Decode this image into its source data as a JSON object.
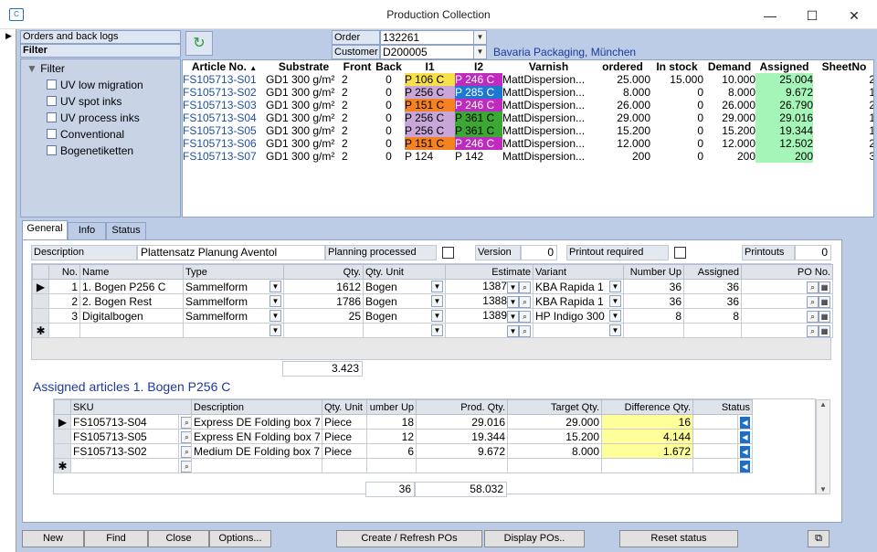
{
  "window": {
    "title": "Production Collection",
    "minimize": "—",
    "maximize": "☐",
    "close": "✕"
  },
  "left_panel": {
    "header1": "Orders and back logs",
    "header2": "Filter",
    "root": "Filter",
    "items": [
      "UV low migration",
      "UV spot inks",
      "UV process inks",
      "Conventional",
      "Bogenetiketten"
    ]
  },
  "order": {
    "order_label": "Order",
    "order_value": "132261",
    "customer_label": "Customer",
    "customer_value": "D200005",
    "customer_name": "Bavaria Packaging, München"
  },
  "articles": {
    "columns": [
      "Article No.",
      "Substrate",
      "Front",
      "Back",
      "I1",
      "I2",
      "Varnish",
      "ordered",
      "In stock",
      "Demand",
      "Assigned",
      "SheetNo"
    ],
    "rows": [
      {
        "article": "FS105713-S01",
        "substrate": "GD1 300 g/m²",
        "front": "2",
        "back": "0",
        "i1": "P 106 C",
        "i1_color": "#f7e04a",
        "i2": "P 246 C",
        "i2_color": "#c02bbf",
        "varnish": "MattDispersion...",
        "ordered": "25.000",
        "stock": "15.000",
        "demand": "10.000",
        "assigned": "25.004",
        "sheet": "2"
      },
      {
        "article": "FS105713-S02",
        "substrate": "GD1 300 g/m²",
        "front": "2",
        "back": "0",
        "i1": "P 256 C",
        "i1_color": "#c9a6d8",
        "i2": "P 285 C",
        "i2_color": "#1e78d2",
        "varnish": "MattDispersion...",
        "ordered": "8.000",
        "stock": "0",
        "demand": "8.000",
        "assigned": "9.672",
        "sheet": "1"
      },
      {
        "article": "FS105713-S03",
        "substrate": "GD1 300 g/m²",
        "front": "2",
        "back": "0",
        "i1": "P 151 C",
        "i1_color": "#f58220",
        "i2": "P 246 C",
        "i2_color": "#c02bbf",
        "varnish": "MattDispersion...",
        "ordered": "26.000",
        "stock": "0",
        "demand": "26.000",
        "assigned": "26.790",
        "sheet": "2"
      },
      {
        "article": "FS105713-S04",
        "substrate": "GD1 300 g/m²",
        "front": "2",
        "back": "0",
        "i1": "P 256 C",
        "i1_color": "#c9a6d8",
        "i2": "P 361 C",
        "i2_color": "#3aa832",
        "varnish": "MattDispersion...",
        "ordered": "29.000",
        "stock": "0",
        "demand": "29.000",
        "assigned": "29.016",
        "sheet": "1"
      },
      {
        "article": "FS105713-S05",
        "substrate": "GD1 300 g/m²",
        "front": "2",
        "back": "0",
        "i1": "P 256 C",
        "i1_color": "#c9a6d8",
        "i2": "P 361 C",
        "i2_color": "#3aa832",
        "varnish": "MattDispersion...",
        "ordered": "15.200",
        "stock": "0",
        "demand": "15.200",
        "assigned": "19.344",
        "sheet": "1"
      },
      {
        "article": "FS105713-S06",
        "substrate": "GD1 300 g/m²",
        "front": "2",
        "back": "0",
        "i1": "P 151 C",
        "i1_color": "#f58220",
        "i2": "P 246 C",
        "i2_color": "#c02bbf",
        "varnish": "MattDispersion...",
        "ordered": "12.000",
        "stock": "0",
        "demand": "12.000",
        "assigned": "12.502",
        "sheet": "2"
      },
      {
        "article": "FS105713-S07",
        "substrate": "GD1 300 g/m²",
        "front": "2",
        "back": "0",
        "i1": "P 124",
        "i1_color": "",
        "i2": "P 142",
        "i2_color": "",
        "varnish": "MattDispersion...",
        "ordered": "200",
        "stock": "0",
        "demand": "200",
        "assigned": "200",
        "sheet": "3"
      }
    ]
  },
  "tabs": [
    "General",
    "Info",
    "Status"
  ],
  "general": {
    "description_label": "Description",
    "description_value": "Plattensatz Planung Aventol",
    "planning_label": "Planning processed",
    "version_label": "Version",
    "version_value": "0",
    "printout_label": "Printout required",
    "printouts_label": "Printouts",
    "printouts_value": "0"
  },
  "forms": {
    "columns": [
      "No.",
      "Name",
      "Type",
      "Qty.",
      "Qty. Unit",
      "Estimate",
      "Variant",
      "Number Up",
      "Assigned",
      "PO No."
    ],
    "rows": [
      {
        "no": "1",
        "name": "1. Bogen P256 C",
        "type": "Sammelform",
        "qty": "1612",
        "unit": "Bogen",
        "estimate": "1387",
        "variant": "KBA Rapida 1",
        "numup": "36",
        "assigned": "36"
      },
      {
        "no": "2",
        "name": "2. Bogen Rest",
        "type": "Sammelform",
        "qty": "1786",
        "unit": "Bogen",
        "estimate": "1388",
        "variant": "KBA Rapida 1",
        "numup": "36",
        "assigned": "36"
      },
      {
        "no": "3",
        "name": "Digitalbogen",
        "type": "Sammelform",
        "qty": "25",
        "unit": "Bogen",
        "estimate": "1389",
        "variant": "HP Indigo 300",
        "numup": "8",
        "assigned": "8"
      }
    ],
    "total": "3.423"
  },
  "assigned": {
    "title": "Assigned articles 1. Bogen P256 C",
    "columns": [
      "SKU",
      "Description",
      "Qty. Unit",
      "umber Up",
      "Prod. Qty.",
      "Target Qty.",
      "Difference Qty.",
      "Status"
    ],
    "rows": [
      {
        "sku": "FS105713-S04",
        "desc": "Express DE Folding box 7",
        "unit": "Piece",
        "numup": "18",
        "prod": "29.016",
        "target": "29.000",
        "diff": "16"
      },
      {
        "sku": "FS105713-S05",
        "desc": "Express EN Folding box 7",
        "unit": "Piece",
        "numup": "12",
        "prod": "19.344",
        "target": "15.200",
        "diff": "4.144"
      },
      {
        "sku": "FS105713-S02",
        "desc": "Medium DE Folding box 7",
        "unit": "Piece",
        "numup": "6",
        "prod": "9.672",
        "target": "8.000",
        "diff": "1.672"
      }
    ],
    "total_numup": "36",
    "total_prod": "58.032"
  },
  "buttons": {
    "new": "New",
    "find": "Find",
    "close": "Close",
    "options": "Options...",
    "create": "Create / Refresh POs",
    "display": "Display POs..",
    "reset": "Reset status"
  }
}
